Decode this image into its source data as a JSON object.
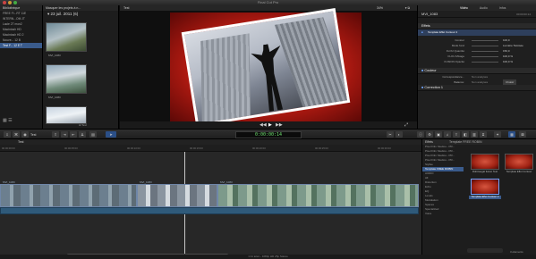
{
  "app": {
    "title": "Final Cut Pro"
  },
  "library": {
    "header": "Bibliothèque",
    "items": [
      {
        "label": "FREE FI...RT 11E",
        "selected": false
      },
      {
        "label": "INTERN...OM JT",
        "selected": false
      },
      {
        "label": "Lacie 2T mon2",
        "selected": false
      },
      {
        "label": "Macintosh HD",
        "selected": false
      },
      {
        "label": "Macintosh HD 2",
        "selected": false
      },
      {
        "label": "Nouve... 12 B",
        "selected": false
      },
      {
        "label": "Test F... 12 E T",
        "selected": true
      }
    ]
  },
  "browser": {
    "header": "Masquer les projets à n...",
    "date": "23 juil. 2011  (6)",
    "clips": [
      "MVI_1083",
      "MVI_1083",
      "MVI_1083"
    ],
    "footer_label": "Test"
  },
  "viewer": {
    "title": "Test",
    "zoom": "34%"
  },
  "inspector": {
    "tabs": [
      "Vidéo",
      "Audio",
      "Infos"
    ],
    "active_tab": "Vidéo",
    "clip_name": "MVI_1083",
    "clip_time": "00:00:00:14",
    "effects_header": "Effets",
    "effect_name": "Template Effet Contour 2",
    "rows": [
      {
        "label": "Contour",
        "value": "100,0"
      },
      {
        "label": "Mode fond",
        "value": "Lumière Tamisée"
      },
      {
        "label": "FLOU Quantité",
        "value": "150,0"
      },
      {
        "label": "FLOU Mixage",
        "value": "100,0 %"
      },
      {
        "label": "FUSION Opacité",
        "value": "100,0 %"
      }
    ],
    "color_header": "Couleur",
    "correspondance_label": "Correspondance...",
    "correspondance_value": "Non analysés",
    "balance_label": "Balance:",
    "balance_value": "Non analysés",
    "choose_label": "Choisir",
    "correction_label": "Correction 1"
  },
  "toolbar": {
    "timecode": "0:00:00:14",
    "project_label": "Test"
  },
  "timeline": {
    "ruler": [
      "00:00:00:00",
      "00:00:05:00",
      "00:00:10:00",
      "00:00:15:00",
      "00:00:20:00",
      "00:00:25:00",
      "00:00:30:00"
    ],
    "clips": [
      "MVI_1083",
      "MVI_1083",
      "MVI_1083"
    ]
  },
  "effects": {
    "header": "Effets",
    "category_title": "Template FREE ROBIN",
    "categories": [
      {
        "label": "Pixel Film Studios - PR...",
        "selected": false
      },
      {
        "label": "Pixel Film Studios - PR...",
        "selected": false
      },
      {
        "label": "Pixel Film Studios - PR...",
        "selected": false
      },
      {
        "label": "Pixel Film Studios - PR...",
        "selected": false
      },
      {
        "label": "Stylise",
        "selected": false
      },
      {
        "label": "Template FREE ROBIN",
        "selected": true
      },
      {
        "label": "AUDIO",
        "selected": false
      },
      {
        "label": "All",
        "selected": false
      },
      {
        "label": "Distortion",
        "selected": false
      },
      {
        "label": "Echo",
        "selected": false
      },
      {
        "label": "EQ",
        "selected": false
      },
      {
        "label": "Levels",
        "selected": false
      },
      {
        "label": "Modulation",
        "selected": false
      },
      {
        "label": "Spaces",
        "selected": false
      },
      {
        "label": "Specialized",
        "selected": false
      },
      {
        "label": "Voice",
        "selected": false
      }
    ],
    "items": [
      {
        "label": "Robinsegal fusion Test",
        "selected": false
      },
      {
        "label": "Template Effet Contour",
        "selected": false
      },
      {
        "label": "Template Effet Contour 2",
        "selected": true
      }
    ],
    "count": "3 éléments"
  },
  "status": {
    "text": "1:11 total – 1080p HD 25p Stéréo"
  }
}
